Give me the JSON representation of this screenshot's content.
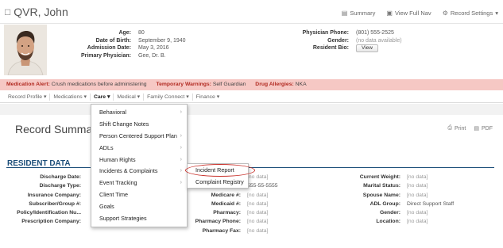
{
  "header": {
    "resident_name": "QVR, John",
    "links": {
      "summary": "Summary",
      "view_full_nav": "View Full Nav",
      "record_settings": "Record Settings"
    }
  },
  "profile": {
    "left": [
      {
        "label": "Age:",
        "value": "80"
      },
      {
        "label": "Date of Birth:",
        "value": "September 9, 1940"
      },
      {
        "label": "Admission Date:",
        "value": "May 3, 2016"
      },
      {
        "label": "Primary Physician:",
        "value": "Gee, Dr. B."
      }
    ],
    "right": {
      "physician_phone_label": "Physician Phone:",
      "physician_phone": "(801) 555-2525",
      "gender_label": "Gender:",
      "gender": "(no data available)",
      "resident_bio_label": "Resident Bio:",
      "view_button": "View"
    }
  },
  "alerts": {
    "medication_label": "Medication Alert:",
    "medication": "Crush medications before administering",
    "warning_label": "Temporary Warnings:",
    "warning": "Self Guardian",
    "allergy_label": "Drug Allergies:",
    "allergy": "NKA"
  },
  "nav": {
    "items": [
      "Record Profile ▾",
      "Medications ▾",
      "Care ▾",
      "Medical ▾",
      "Family Connect ▾",
      "Finance ▾"
    ]
  },
  "record_summary": {
    "title": "Record Summary",
    "print": "Print",
    "pdf": "PDF"
  },
  "resident_data": {
    "title": "RESIDENT DATA",
    "col1": [
      {
        "label": "Discharge Date:",
        "value": ""
      },
      {
        "label": "Discharge Type:",
        "value": ""
      },
      {
        "label": "Insurance Company:",
        "value": ""
      },
      {
        "label": "Subscriber/Group #:",
        "value": ""
      },
      {
        "label": "Policy/Identification Nu...",
        "value": ""
      },
      {
        "label": "Prescription Company:",
        "value": ""
      }
    ],
    "col2": [
      {
        "label": "",
        "value": "[no data]"
      },
      {
        "label": "",
        "value": "555-55-5555"
      },
      {
        "label": "Medicare #:",
        "value": "[no data]"
      },
      {
        "label": "Medicaid #:",
        "value": "[no data]"
      },
      {
        "label": "Pharmacy:",
        "value": "[no data]"
      },
      {
        "label": "Pharmacy Phone:",
        "value": "[no data]"
      },
      {
        "label": "Pharmacy Fax:",
        "value": "[no data]"
      }
    ],
    "col3": [
      {
        "label": "Current Weight:",
        "value": "[no data]"
      },
      {
        "label": "Marital Status:",
        "value": "[no data]"
      },
      {
        "label": "Spouse Name:",
        "value": "[no data]"
      },
      {
        "label": "ADL Group:",
        "value": "Direct Support Staff"
      },
      {
        "label": "Gender:",
        "value": "[no data]"
      },
      {
        "label": "Location:",
        "value": "[no data]"
      }
    ]
  },
  "care_menu": {
    "items": [
      {
        "label": "Behavioral",
        "submenu": true
      },
      {
        "label": "Shift Change Notes",
        "submenu": false
      },
      {
        "label": "Person Centered Support Plan",
        "submenu": true
      },
      {
        "label": "ADLs",
        "submenu": true
      },
      {
        "label": "Human Rights",
        "submenu": true
      },
      {
        "label": "Incidents & Complaints",
        "submenu": true
      },
      {
        "label": "Event Tracking",
        "submenu": true
      },
      {
        "label": "Client Time",
        "submenu": false
      },
      {
        "label": "Goals",
        "submenu": false
      },
      {
        "label": "Support Strategies",
        "submenu": false
      }
    ],
    "submenu_items": [
      "Incident Report",
      "Complaint Registry"
    ]
  },
  "colors": {
    "alert_bg": "#f6c8c4",
    "alert_label": "#b22b22",
    "section_title": "#1d4f7a",
    "highlight": "#c8302a"
  }
}
